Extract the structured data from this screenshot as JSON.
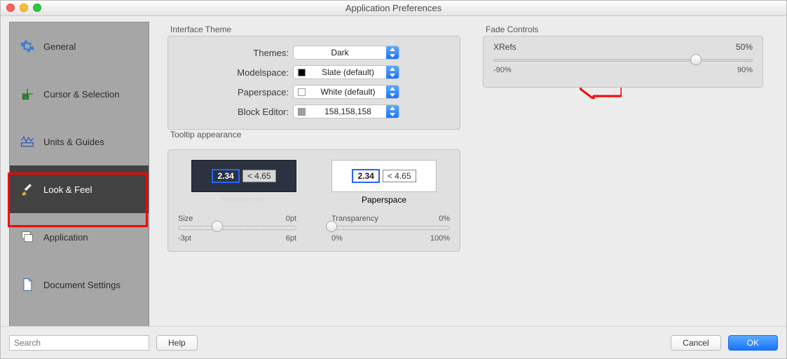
{
  "window": {
    "title": "Application Preferences"
  },
  "sidebar": {
    "items": [
      {
        "label": "General"
      },
      {
        "label": "Cursor & Selection"
      },
      {
        "label": "Units & Guides"
      },
      {
        "label": "Look & Feel"
      },
      {
        "label": "Application"
      },
      {
        "label": "Document Settings"
      }
    ],
    "selected_index": 3
  },
  "interface_theme": {
    "group_label": "Interface Theme",
    "rows": {
      "themes": {
        "label": "Themes:",
        "value": "Dark"
      },
      "modelspace": {
        "label": "Modelspace:",
        "value": "Slate (default)",
        "swatch": "#000000"
      },
      "paperspace": {
        "label": "Paperspace:",
        "value": "White (default)",
        "swatch": "#ffffff"
      },
      "block_editor": {
        "label": "Block Editor:",
        "value": "158,158,158",
        "swatch": "#9e9e9e"
      }
    }
  },
  "fade": {
    "group_label": "Fade Controls",
    "xrefs_label": "XRefs",
    "xrefs_value": "50%",
    "min": "-90%",
    "max": "90%",
    "thumb_pct": 78
  },
  "tooltip": {
    "group_label": "Tooltip appearance",
    "sample_bold": "2.34",
    "sample_gray": "< 4.65",
    "modelspace_caption": "Modelspace",
    "paperspace_caption": "Paperspace",
    "size": {
      "label": "Size",
      "value": "0pt",
      "min": "-3pt",
      "max": "6pt",
      "thumb_pct": 33
    },
    "transp": {
      "label": "Transparency",
      "value": "0%",
      "min": "0%",
      "max": "100%",
      "thumb_pct": 0
    }
  },
  "footer": {
    "search_placeholder": "Search",
    "help": "Help",
    "cancel": "Cancel",
    "ok": "OK"
  }
}
